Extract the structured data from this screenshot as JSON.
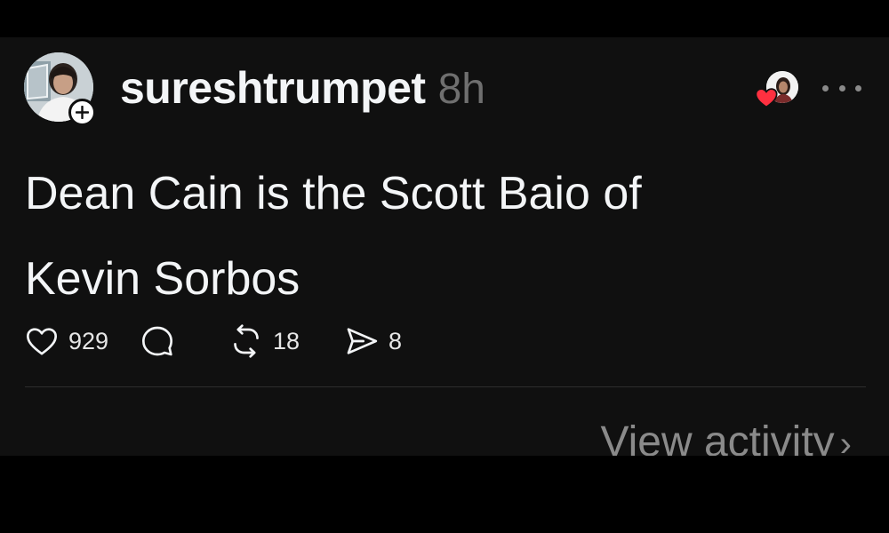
{
  "post": {
    "username": "sureshtrumpet",
    "timestamp": "8h",
    "text_line1": "Dean Cain is the Scott Baio of",
    "text_line2": "Kevin Sorbos"
  },
  "actions": {
    "likes": "929",
    "reposts": "18",
    "shares": "8"
  },
  "footer": {
    "view_activity": "View activity",
    "chevron": "›"
  },
  "icons": {
    "follow": "plus-icon",
    "reactor_heart": "heart-filled-icon",
    "more": "more-horizontal-icon",
    "like": "heart-outline-icon",
    "reply": "speech-bubble-icon",
    "repost": "repost-arrows-icon",
    "share": "send-icon"
  },
  "colors": {
    "background": "#101010",
    "text": "#f3f5f7",
    "muted": "#6f6f6f",
    "heart": "#ff3040"
  }
}
